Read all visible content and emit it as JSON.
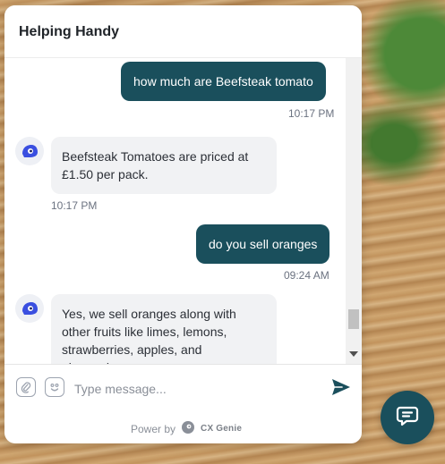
{
  "header": {
    "title": "Helping Handy"
  },
  "messages": [
    {
      "sender": "user",
      "text": "how much are Beefsteak tomato",
      "time": "10:17 PM"
    },
    {
      "sender": "bot",
      "text": "Beefsteak Tomatoes are priced at £1.50 per pack.",
      "time": "10:17 PM"
    },
    {
      "sender": "user",
      "text": "do you sell oranges",
      "time": "09:24 AM"
    },
    {
      "sender": "bot",
      "text": "Yes, we sell oranges along with other fruits like limes, lemons, strawberries, apples, and pineapples."
    }
  ],
  "composer": {
    "placeholder": "Type message..."
  },
  "footer": {
    "powered_by": "Power by",
    "brand": "CX Genie"
  },
  "colors": {
    "accent": "#1a4f5c",
    "bot_bubble": "#f1f2f4"
  },
  "icons": {
    "attach": "attach-icon",
    "emoji": "emoji-icon",
    "send": "send-icon",
    "bot_avatar": "bot-avatar-icon",
    "launcher": "chat-icon"
  }
}
